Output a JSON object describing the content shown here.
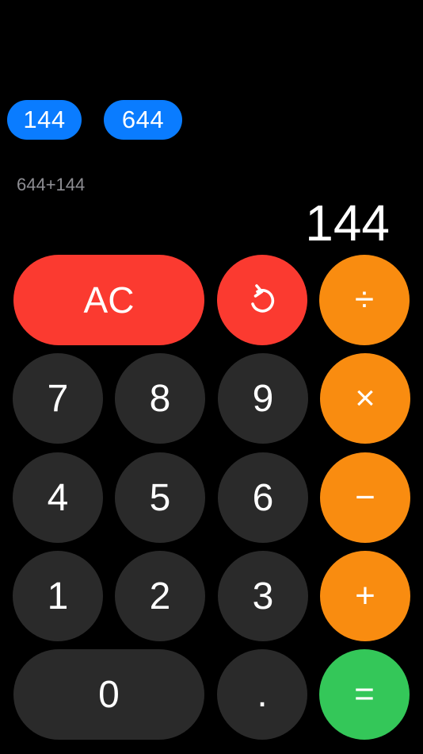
{
  "history_chips": [
    {
      "label": "144"
    },
    {
      "label": "644"
    }
  ],
  "display": {
    "expression": "644+144",
    "result": "144"
  },
  "keys": {
    "ac": "AC",
    "undo_icon": "undo-arrow-icon",
    "divide": "÷",
    "multiply": "×",
    "subtract": "−",
    "add": "+",
    "equals": "=",
    "seven": "7",
    "eight": "8",
    "nine": "9",
    "four": "4",
    "five": "5",
    "six": "6",
    "one": "1",
    "two": "2",
    "three": "3",
    "zero": "0",
    "decimal": "."
  },
  "colors": {
    "background": "#000000",
    "number_key": "#2a2a2a",
    "operator_key": "#f98c10",
    "clear_key": "#fb3a30",
    "equals_key": "#34c759",
    "chip": "#0a7cff",
    "expression_text": "#8e8e93"
  }
}
